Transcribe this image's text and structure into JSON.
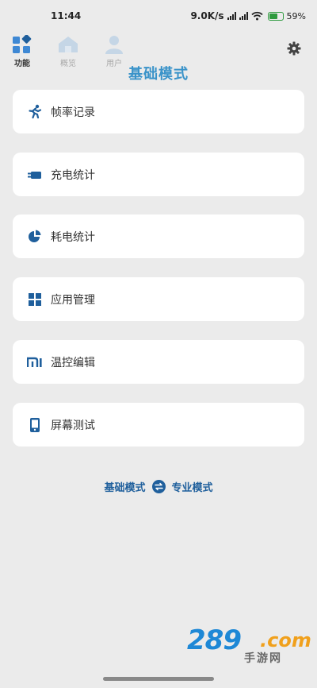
{
  "status_bar": {
    "time": "11:44",
    "network_speed": "9.0K/s",
    "battery_percent": "59%",
    "battery_level": 0.59
  },
  "tabs": [
    {
      "label": "功能",
      "icon": "function-grid-icon",
      "active": true
    },
    {
      "label": "概览",
      "icon": "overview-home-icon",
      "active": false
    },
    {
      "label": "用户",
      "icon": "user-icon",
      "active": false
    }
  ],
  "header": {
    "title": "基础模式",
    "settings_icon": "gear-icon"
  },
  "menu": [
    {
      "label": "帧率记录",
      "icon": "running-person-icon"
    },
    {
      "label": "充电统计",
      "icon": "charging-plug-icon"
    },
    {
      "label": "耗电统计",
      "icon": "pie-chart-icon"
    },
    {
      "label": "应用管理",
      "icon": "app-grid-icon"
    },
    {
      "label": "温控编辑",
      "icon": "mi-logo-icon"
    },
    {
      "label": "屏幕测试",
      "icon": "phone-screen-icon"
    }
  ],
  "mode_switch": {
    "left_label": "基础模式",
    "right_label": "专业模式",
    "icon": "swap-icon"
  },
  "watermark": {
    "number": "289",
    "suffix": ".com",
    "text": "手游网"
  },
  "colors": {
    "background": "#ebebeb",
    "accent_title": "#3a93c9",
    "icon_blue": "#1f5f9c",
    "mode_text": "#1f5f9c",
    "battery_green": "#2e9a3e"
  }
}
